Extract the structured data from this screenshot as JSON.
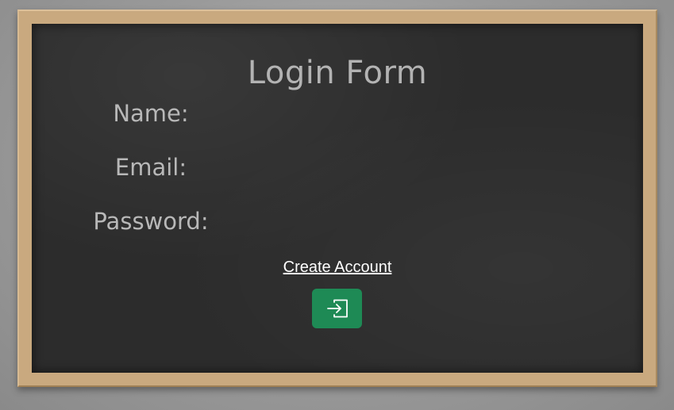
{
  "form": {
    "title": "Login Form",
    "fields": [
      {
        "label": "Name:"
      },
      {
        "label": "Email:"
      },
      {
        "label": "Password:"
      }
    ],
    "create_account_label": "Create Account",
    "submit_icon": "login-icon"
  },
  "colors": {
    "board": "#2c2c2c",
    "frame": "#c9a97f",
    "button": "#1e8a55",
    "label_text": "#b8b8b8",
    "link_text": "#ffffff"
  }
}
